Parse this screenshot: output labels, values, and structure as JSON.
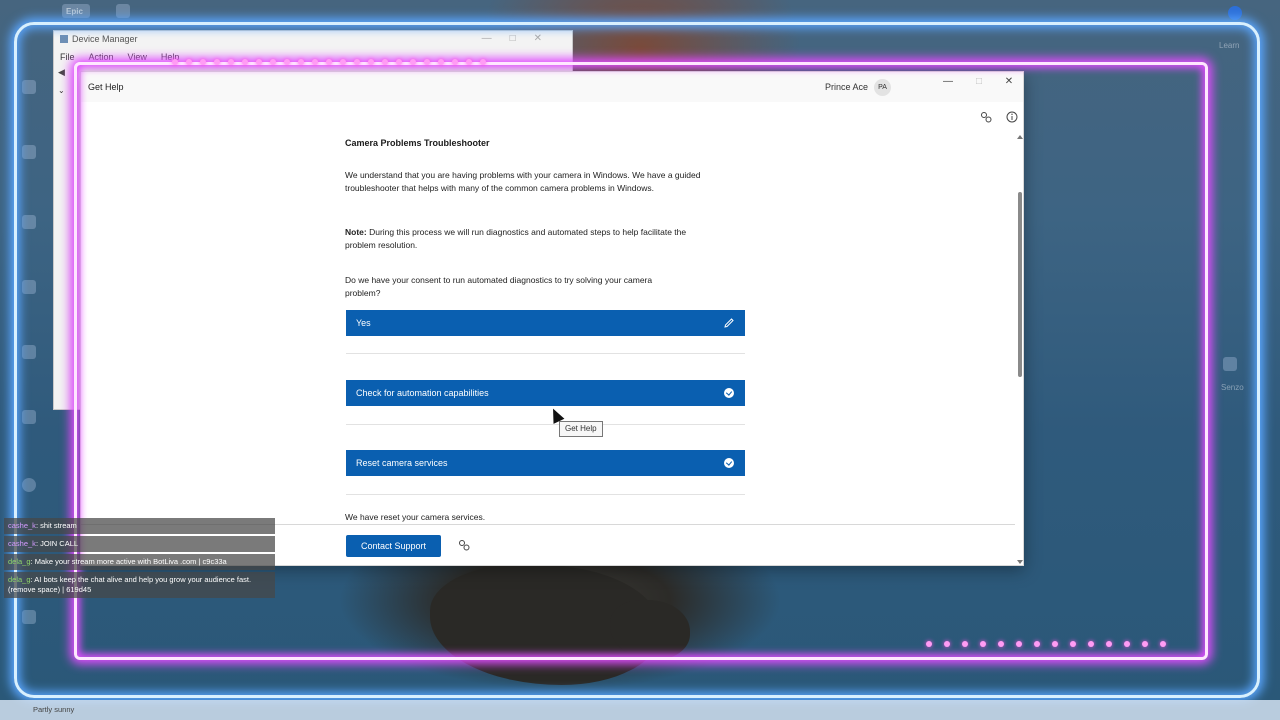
{
  "device_manager": {
    "title": "Device Manager",
    "menu": [
      "File",
      "Action",
      "View",
      "Help"
    ]
  },
  "get_help": {
    "window_title": "Get Help",
    "user_name": "Prince Ace",
    "user_initials": "PA",
    "heading": "Camera Problems Troubleshooter",
    "intro": "We understand that you are having problems with your camera in Windows. We have a guided troubleshooter that helps with many of the common camera problems in Windows.",
    "note_label": "Note:",
    "note_text": " During this process we will run diagnostics and automated steps to help facilitate the problem resolution.",
    "consent_question": "Do we have your consent to run automated diagnostics to try solving your camera problem?",
    "yes_label": "Yes",
    "step1_label": "Check for automation capabilities",
    "step2_label": "Reset camera services",
    "reset_message": "We have reset your camera services.",
    "contact_label": "Contact Support",
    "tooltip": "Get Help"
  },
  "chat": [
    {
      "user": "cashe_k",
      "text": ": shit stream"
    },
    {
      "user": "cashe_k",
      "text": ": JOIN CALL"
    },
    {
      "user": "dela_g",
      "text": ": Make your stream more active with BotLiva .com | c9c33a"
    },
    {
      "user": "dela_g",
      "text": ": AI bots keep the chat alive and help you grow your audience fast. (remove space) | 619d45"
    }
  ],
  "taskbar": {
    "weather": "Partly sunny"
  },
  "desktop_icons": [
    "Epic",
    "Learn",
    "Senzo"
  ],
  "colors": {
    "accent": "#0a5fb0",
    "neon_blue": "#5aa6ff",
    "neon_pink": "#e14cff"
  }
}
